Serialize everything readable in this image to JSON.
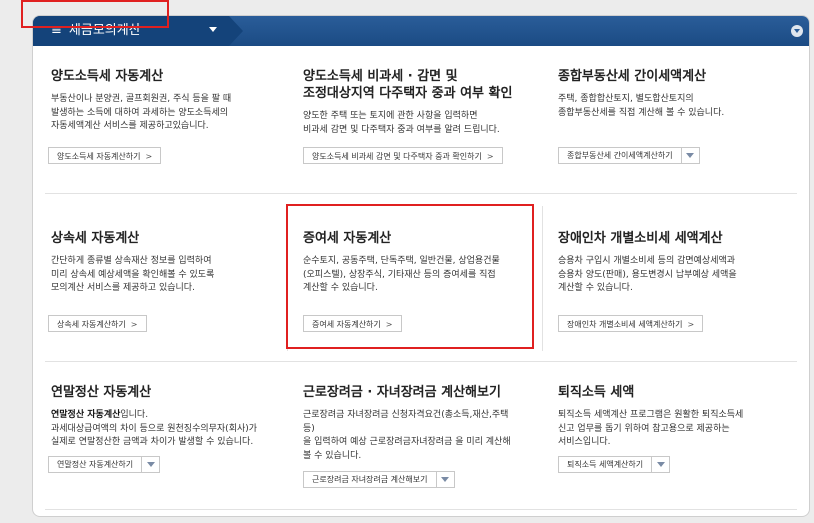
{
  "header": {
    "menu_label": "세금모의계산",
    "menu_icon": "hamburger-icon"
  },
  "cards": [
    {
      "title": "양도소득세 자동계산",
      "desc": [
        "부동산이나 분양권, 골프회원권, 주식 등을 팔 때",
        "발생하는 소득에 대하여 과세하는 양도소득세의",
        "자동세액계산 서비스를 제공하고있습니다."
      ],
      "button": "양도소득세 자동계산하기"
    },
    {
      "title": [
        "양도소득세 비과세 · 감면 및",
        "조정대상지역 다주택자 중과 여부 확인"
      ],
      "desc": [
        "양도한 주택 또는 토지에 관한 사항을 입력하면",
        "비과세 감면 및 다주택자 중과 여부를 알려 드립니다."
      ],
      "button": "양도소득세 비과세 감면 및 다주택자 중과 확인하기"
    },
    {
      "title": "종합부동산세 간이세액계산",
      "desc": [
        "주택, 종합합산토지, 별도합산토지의",
        "종합부동산세를 직접 계산해 볼 수 있습니다."
      ],
      "select": "종합부동산세 간이세액계산하기"
    },
    {
      "title": "상속세 자동계산",
      "desc": [
        "간단하게 종류별 상속재산 정보를 입력하여",
        "미리 상속세 예상세액을 확인해볼 수 있도록",
        "모의계산 서비스를 제공하고 있습니다."
      ],
      "button": "상속세 자동계산하기"
    },
    {
      "title": "증여세 자동계산",
      "desc": [
        "순수토지, 공동주택, 단독주택, 일반건물, 상업용건물",
        "(오피스텔), 상장주식, 기타재산 등의 증여세를 직접",
        "계산할 수 있습니다."
      ],
      "button": "증여세 자동계산하기"
    },
    {
      "title": "장애인차 개별소비세 세액계산",
      "desc": [
        "승용차 구입시 개별소비세 등의 감면예상세액과",
        "승용차 양도(판매), 용도변경시 납부예상 세액을",
        "계산할 수 있습니다."
      ],
      "button": "장애인차 개별소비세 세액계산하기"
    },
    {
      "title": "연말정산 자동계산",
      "desc_bold": "연말정산 자동계산",
      "desc_first_rest": "입니다.",
      "desc": [
        "과세대상급여액의 차이 등으로 원천징수의무자(회사)가",
        "실제로 연말정산한 금액과 차이가 발생할 수 있습니다."
      ],
      "select": "연말정산 자동계산하기"
    },
    {
      "title": "근로장려금 · 자녀장려금 계산해보기",
      "desc": [
        "근로장려금 자녀장려금 신청자격요건(총소득,재산,주택",
        "등)",
        "을 입력하여 예상 근로장려금자녀장려금 을 미리 계산해",
        "볼 수 있습니다."
      ],
      "select": "근로장려금 자녀장려금 계산해보기"
    },
    {
      "title": "퇴직소득 세액",
      "desc": [
        "퇴직소득 세액계산 프로그램은 원활한 퇴직소득세",
        "신고 업무를 돕기 위하여 참고용으로 제공하는",
        "서비스입니다."
      ],
      "select": "퇴직소득 세액계산하기"
    }
  ]
}
